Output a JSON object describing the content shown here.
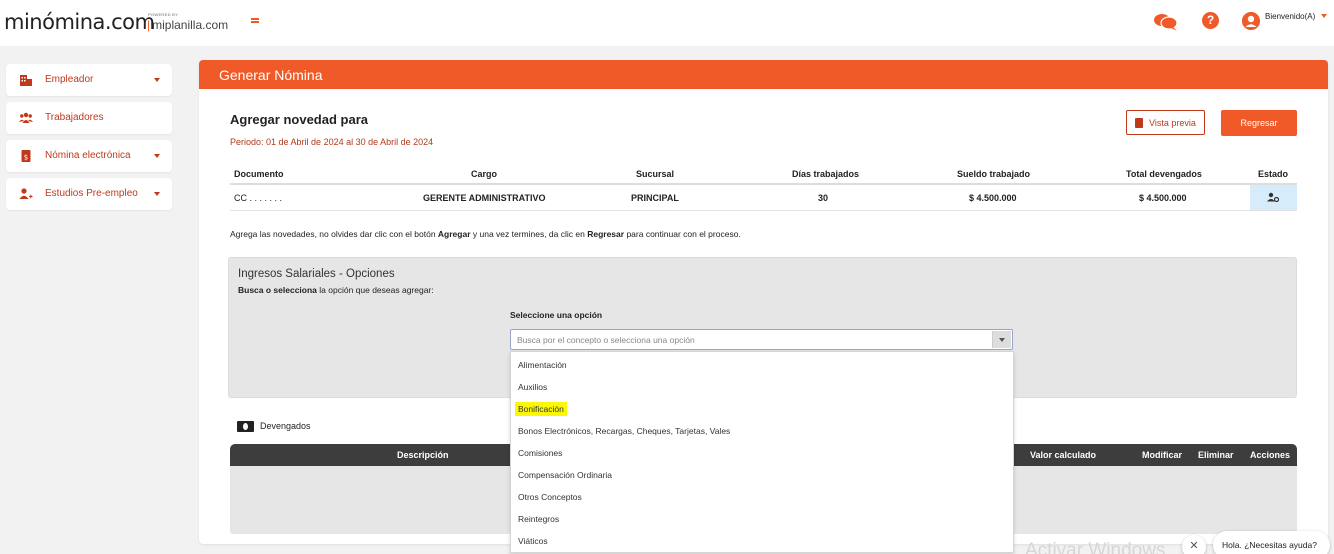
{
  "header": {
    "logo_text": "minómina.com",
    "powered_by": "POWERED BY",
    "partner": "miplanilla.com",
    "welcome": "Bienvenido(A)"
  },
  "sidebar": {
    "items": [
      {
        "label": "Empleador",
        "icon": "building-icon",
        "has_caret": true
      },
      {
        "label": "Trabajadores",
        "icon": "users-icon",
        "has_caret": false
      },
      {
        "label": "Nómina electrónica",
        "icon": "document-icon",
        "has_caret": true
      },
      {
        "label": "Estudios Pre-empleo",
        "icon": "user-plus-icon",
        "has_caret": true
      }
    ]
  },
  "page": {
    "title": "Generar Nómina",
    "subtitle": "Agregar novedad para",
    "period": "Periodo: 01 de Abril de 2024 al 30 de Abril de 2024",
    "preview_label": "Vista previa",
    "back_label": "Regresar"
  },
  "employee_table": {
    "headers": [
      "Documento",
      "Cargo",
      "Sucursal",
      "Días trabajados",
      "Sueldo trabajado",
      "Total devengados",
      "Estado"
    ],
    "row": {
      "documento": "CC . . . . . . .",
      "cargo": "GERENTE ADMINISTRATIVO",
      "sucursal": "PRINCIPAL",
      "dias": "30",
      "sueldo": "$ 4.500.000",
      "total": "$ 4.500.000"
    }
  },
  "hint": {
    "part1": "Agrega las novedades, no olvides dar clic con el botón ",
    "bold1": "Agregar",
    "part2": " y una vez termines, da clic en ",
    "bold2": "Regresar",
    "part3": " para continuar con el proceso."
  },
  "panel": {
    "title": "Ingresos Salariales - Opciones",
    "sub_bold": "Busca o selecciona",
    "sub_rest": " la opción que deseas agregar:",
    "select_label": "Seleccione una opción",
    "select_placeholder": "Busca por el concepto o selecciona una opción"
  },
  "dropdown": {
    "options": [
      "Alimentación",
      "Auxilios",
      "Bonificación",
      "Bonos Electrónicos, Recargas, Cheques, Tarjetas, Vales",
      "Comisiones",
      "Compensación Ordinaria",
      "Otros Conceptos",
      "Reintegros",
      "Viáticos"
    ],
    "highlighted": "Bonificación",
    "highlight_color": "#fbf705"
  },
  "devengados": {
    "label": "Devengados",
    "headers": [
      "Descripción",
      "Valor calculado",
      "Modificar",
      "Eliminar",
      "Acciones"
    ]
  },
  "footer": {
    "watermark": "Activar Windows",
    "chat_close": "✕",
    "chat_text": "Hola. ¿Necesitas ayuda?"
  },
  "colors": {
    "accent": "#f05a28",
    "accent_dark": "#c0391b",
    "status_cell": "#d7ecfb"
  }
}
